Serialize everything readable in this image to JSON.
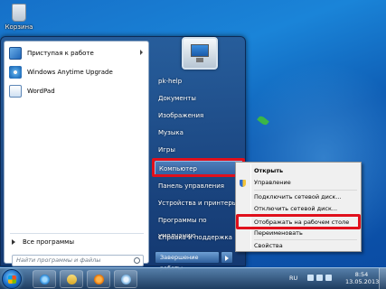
{
  "desktop": {
    "recycle_bin_label": "Корзина"
  },
  "start_menu": {
    "programs": [
      {
        "label": "Приступая к работе",
        "icon": "getting-started-icon",
        "has_submenu": true
      },
      {
        "label": "Windows Anytime Upgrade",
        "icon": "anytime-upgrade-icon",
        "has_submenu": false
      },
      {
        "label": "WordPad",
        "icon": "wordpad-icon",
        "has_submenu": false
      }
    ],
    "all_programs_label": "Все программы",
    "search_placeholder": "Найти программы и файлы",
    "right_items": [
      {
        "label": "pk-help"
      },
      {
        "label": "Документы"
      },
      {
        "label": "Изображения"
      },
      {
        "label": "Музыка"
      },
      {
        "label": "Игры"
      },
      {
        "label": "Компьютер"
      },
      {
        "label": "Панель управления"
      },
      {
        "label": "Устройства и принтеры"
      },
      {
        "label": "Программы по умолчанию"
      },
      {
        "label": "Справка и поддержка"
      }
    ],
    "shutdown_label": "Завершение работы"
  },
  "context_menu": {
    "items": [
      {
        "label": "Открыть",
        "bold": true
      },
      {
        "label": "Управление",
        "icon": "shield-icon"
      },
      {
        "label": "Подключить сетевой диск..."
      },
      {
        "label": "Отключить сетевой диск..."
      },
      {
        "label": "Отображать на рабочем столе"
      },
      {
        "label": "Переименовать"
      },
      {
        "label": "Свойства"
      }
    ]
  },
  "taskbar": {
    "pinned": [
      "internet-explorer-icon",
      "explorer-folder-icon",
      "media-player-icon",
      "app-icon"
    ],
    "language": "RU",
    "time": "8:54",
    "date": "13.05.2013"
  },
  "highlight_color": "#e0101c"
}
